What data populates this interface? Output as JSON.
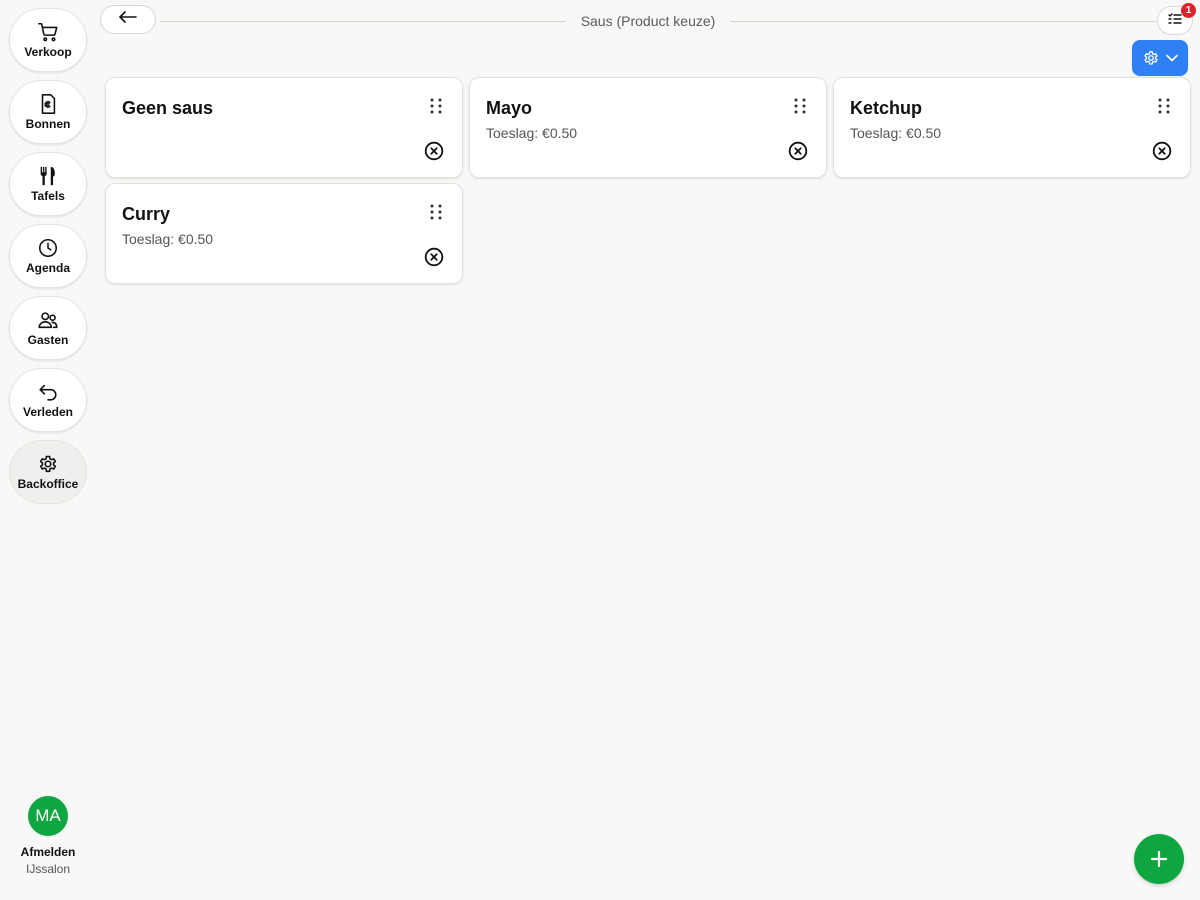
{
  "sidebar": {
    "items": [
      {
        "label": "Verkoop",
        "icon": "cart-icon"
      },
      {
        "label": "Bonnen",
        "icon": "receipt-euro-icon"
      },
      {
        "label": "Tafels",
        "icon": "cutlery-icon"
      },
      {
        "label": "Agenda",
        "icon": "clock-icon"
      },
      {
        "label": "Gasten",
        "icon": "users-icon"
      },
      {
        "label": "Verleden",
        "icon": "undo-icon"
      },
      {
        "label": "Backoffice",
        "icon": "gear-icon",
        "active": true
      }
    ],
    "user": {
      "initials": "MA",
      "logout_label": "Afmelden",
      "org": "IJssalon"
    }
  },
  "header": {
    "title": "Saus (Product keuze)",
    "tasks_badge": "1"
  },
  "cards": [
    {
      "name": "Geen saus",
      "surcharge": ""
    },
    {
      "name": "Mayo",
      "surcharge": "Toeslag: €0.50"
    },
    {
      "name": "Ketchup",
      "surcharge": "Toeslag: €0.50"
    },
    {
      "name": "Curry",
      "surcharge": "Toeslag: €0.50"
    }
  ],
  "colors": {
    "accent_blue": "#2f7ff5",
    "accent_green": "#0ea640",
    "badge_red": "#e2202e",
    "background": "#f8f8f6"
  }
}
